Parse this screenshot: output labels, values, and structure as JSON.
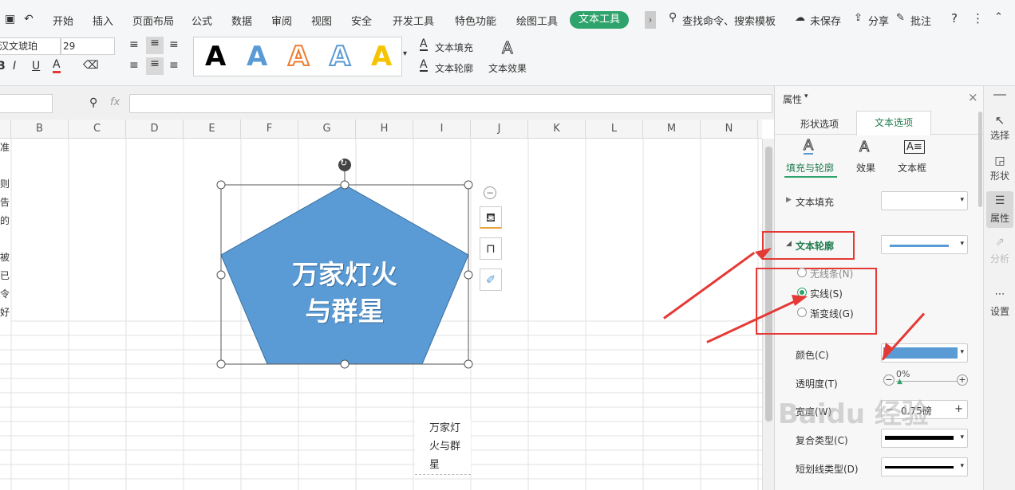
{
  "menubar": {
    "items": [
      "开始",
      "插入",
      "页面布局",
      "公式",
      "数据",
      "审阅",
      "视图",
      "安全",
      "开发工具",
      "特色功能",
      "绘图工具"
    ],
    "active": "文本工具",
    "search": "查找命令、搜索模板",
    "unsaved": "未保存",
    "share": "分享",
    "comment": "批注"
  },
  "ribbon": {
    "font_name": "汉文琥珀",
    "font_size": "29",
    "text_fill": "文本填充",
    "text_outline": "文本轮廓",
    "text_effect": "文本效果",
    "style_letter": "A"
  },
  "formula": {
    "fx": "fx"
  },
  "columns": [
    "B",
    "C",
    "D",
    "E",
    "F",
    "G",
    "H",
    "I",
    "J",
    "K",
    "L",
    "M",
    "N"
  ],
  "left_chars": [
    "准",
    "",
    "则",
    "告",
    "的",
    "",
    "被",
    "已",
    "令",
    "好"
  ],
  "shape": {
    "line1": "万家灯火",
    "line2": "与群星",
    "color": "#5b9bd5"
  },
  "cell_text": [
    "万家灯",
    "火与群",
    "星"
  ],
  "panel": {
    "title": "属性",
    "tab_shape": "形状选项",
    "tab_text": "文本选项",
    "sub_fill": "填充与轮廓",
    "sub_effect": "效果",
    "sub_box": "文本框",
    "text_fill": "文本填充",
    "text_outline": "文本轮廓",
    "opt_none": "无线条(N)",
    "opt_solid": "实线(S)",
    "opt_grad": "渐变线(G)",
    "color_label": "颜色(C)",
    "color": "#5b9bd5",
    "transparency_label": "透明度(T)",
    "transparency": "0%",
    "width_label": "宽度(W)",
    "width": "0.75磅",
    "compound_label": "复合类型(C)",
    "dash_label": "短划线类型(D)"
  },
  "rightbar": {
    "select": "选择",
    "shape": "形状",
    "property": "属性",
    "analysis": "分析",
    "settings": "设置"
  },
  "watermark": "Baidu 经验"
}
